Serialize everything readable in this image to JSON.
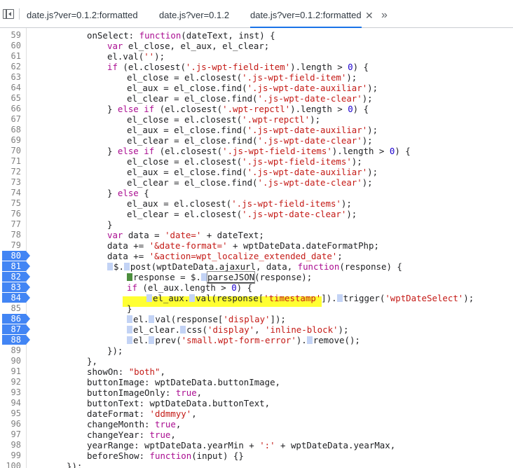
{
  "tabs": [
    {
      "label": "date.js?ver=0.1.2:formatted"
    },
    {
      "label": "date.js?ver=0.1.2"
    },
    {
      "label": "date.js?ver=0.1.2:formatted"
    }
  ],
  "icons": {
    "toggle": "sidebar-toggle-icon",
    "close": "close-icon",
    "more": "more-tabs-icon"
  },
  "glyphs": {
    "close": "✕",
    "more": "»"
  },
  "colors": {
    "breakpoint": "#4285f4",
    "highlight": "#ffff33",
    "inline_breakpoint": "#c3d3f5",
    "paused_marker": "#4c8e3d"
  },
  "lines": [
    {
      "n": "59",
      "bp": false
    },
    {
      "n": "60",
      "bp": false
    },
    {
      "n": "61",
      "bp": false
    },
    {
      "n": "62",
      "bp": false
    },
    {
      "n": "63",
      "bp": false
    },
    {
      "n": "64",
      "bp": false
    },
    {
      "n": "65",
      "bp": false
    },
    {
      "n": "66",
      "bp": false
    },
    {
      "n": "67",
      "bp": false
    },
    {
      "n": "68",
      "bp": false
    },
    {
      "n": "69",
      "bp": false
    },
    {
      "n": "70",
      "bp": false
    },
    {
      "n": "71",
      "bp": false
    },
    {
      "n": "72",
      "bp": false
    },
    {
      "n": "73",
      "bp": false
    },
    {
      "n": "74",
      "bp": false
    },
    {
      "n": "75",
      "bp": false
    },
    {
      "n": "76",
      "bp": false
    },
    {
      "n": "77",
      "bp": false
    },
    {
      "n": "78",
      "bp": false
    },
    {
      "n": "79",
      "bp": false
    },
    {
      "n": "80",
      "bp": true
    },
    {
      "n": "81",
      "bp": true
    },
    {
      "n": "82",
      "bp": true
    },
    {
      "n": "83",
      "bp": true
    },
    {
      "n": "84",
      "bp": true
    },
    {
      "n": "85",
      "bp": false
    },
    {
      "n": "86",
      "bp": true
    },
    {
      "n": "87",
      "bp": true
    },
    {
      "n": "88",
      "bp": true
    },
    {
      "n": "89",
      "bp": false
    },
    {
      "n": "90",
      "bp": false
    },
    {
      "n": "91",
      "bp": false
    },
    {
      "n": "92",
      "bp": false
    },
    {
      "n": "93",
      "bp": false
    },
    {
      "n": "94",
      "bp": false
    },
    {
      "n": "95",
      "bp": false
    },
    {
      "n": "96",
      "bp": false
    },
    {
      "n": "97",
      "bp": false
    },
    {
      "n": "98",
      "bp": false
    },
    {
      "n": "99",
      "bp": false
    },
    {
      "n": "100",
      "bp": false
    }
  ],
  "code": {
    "l59_a": "onSelect: ",
    "l59_k": "function",
    "l59_b": "(dateText, inst) {",
    "l60_k": "var",
    "l60_a": " el_close, el_aux, el_clear;",
    "l61_a": "el.val(",
    "l61_s": "''",
    "l61_b": ");",
    "l62_k": "if",
    "l62_a": " (el.closest(",
    "l62_s": "'.js-wpt-field-item'",
    "l62_b": ").length > ",
    "l62_n": "0",
    "l62_c": ") {",
    "l63_a": "el_close = el.closest(",
    "l63_s": "'.js-wpt-field-item'",
    "l63_b": ");",
    "l64_a": "el_aux = el_close.find(",
    "l64_s": "'.js-wpt-date-auxiliar'",
    "l64_b": ");",
    "l65_a": "el_clear = el_close.find(",
    "l65_s": "'.js-wpt-date-clear'",
    "l65_b": ");",
    "l66_a": "} ",
    "l66_k1": "else",
    "l66_sp": " ",
    "l66_k2": "if",
    "l66_b": " (el.closest(",
    "l66_s": "'.wpt-repctl'",
    "l66_c": ").length > ",
    "l66_n": "0",
    "l66_d": ") {",
    "l67_a": "el_close = el.closest(",
    "l67_s": "'.wpt-repctl'",
    "l67_b": ");",
    "l68_a": "el_aux = el_close.find(",
    "l68_s": "'.js-wpt-date-auxiliar'",
    "l68_b": ");",
    "l69_a": "el_clear = el_close.find(",
    "l69_s": "'.js-wpt-date-clear'",
    "l69_b": ");",
    "l70_a": "} ",
    "l70_k1": "else",
    "l70_sp": " ",
    "l70_k2": "if",
    "l70_b": " (el.closest(",
    "l70_s": "'.js-wpt-field-items'",
    "l70_c": ").length > ",
    "l70_n": "0",
    "l70_d": ") {",
    "l71_a": "el_close = el.closest(",
    "l71_s": "'.js-wpt-field-items'",
    "l71_b": ");",
    "l72_a": "el_aux = el_close.find(",
    "l72_s": "'.js-wpt-date-auxiliar'",
    "l72_b": ");",
    "l73_a": "el_clear = el_close.find(",
    "l73_s": "'.js-wpt-date-clear'",
    "l73_b": ");",
    "l74_a": "} ",
    "l74_k": "else",
    "l74_b": " {",
    "l75_a": "el_aux = el.closest(",
    "l75_s": "'.js-wpt-field-items'",
    "l75_b": ");",
    "l76_a": "el_clear = el.closest(",
    "l76_s": "'.js-wpt-date-clear'",
    "l76_b": ");",
    "l77_a": "}",
    "l78_k": "var",
    "l78_a": " data = ",
    "l78_s": "'date='",
    "l78_b": " + dateText;",
    "l79_a": "data += ",
    "l79_s": "'&date-format='",
    "l79_b": " + wptDateData.dateFormatPhp;",
    "l80_a": "data += ",
    "l80_s": "'&action=wpt_localize_extended_date'",
    "l80_b": ";",
    "l81_a": "$.",
    "l81_b": "post(wptDateData.ajaxurl, data, ",
    "l81_k": "function",
    "l81_c": "(response) {",
    "l82_a": "response = $.",
    "l82_b": "parseJSON",
    "l82_c": "(response);",
    "l83_k": "if",
    "l83_a": " (el_aux.length > ",
    "l83_n": "0",
    "l83_b": ") {",
    "l84_a": "el_aux.",
    "l84_b": "val(response[",
    "l84_s": "'timestamp'",
    "l84_c": "]).",
    "l84_d": "trigger(",
    "l84_s2": "'wptDateSelect'",
    "l84_e": ");",
    "l85_a": "}",
    "l86_a": "el.",
    "l86_b": "val(response[",
    "l86_s": "'display'",
    "l86_c": "]);",
    "l87_a": "el_clear.",
    "l87_b": "css(",
    "l87_s": "'display'",
    "l87_c": ", ",
    "l87_s2": "'inline-block'",
    "l87_d": ");",
    "l88_a": "el.",
    "l88_b": "prev(",
    "l88_s": "'small.wpt-form-error'",
    "l88_c": ").",
    "l88_d": "remove();",
    "l89_a": "});",
    "l90_a": "},",
    "l91_a": "showOn: ",
    "l91_s": "\"both\"",
    "l91_b": ",",
    "l92_a": "buttonImage: wptDateData.buttonImage,",
    "l93_a": "buttonImageOnly: ",
    "l93_k": "true",
    "l93_b": ",",
    "l94_a": "buttonText: wptDateData.buttonText,",
    "l95_a": "dateFormat: ",
    "l95_s": "'ddmmyy'",
    "l95_b": ",",
    "l96_a": "changeMonth: ",
    "l96_k": "true",
    "l96_b": ",",
    "l97_a": "changeYear: ",
    "l97_k": "true",
    "l97_b": ",",
    "l98_a": "yearRange: wptDateData.yearMin + ",
    "l98_s": "':'",
    "l98_b": " + wptDateData.yearMax,",
    "l99_a": "beforeShow: ",
    "l99_k": "function",
    "l99_b": "(input) {}",
    "l100_a": "});"
  }
}
